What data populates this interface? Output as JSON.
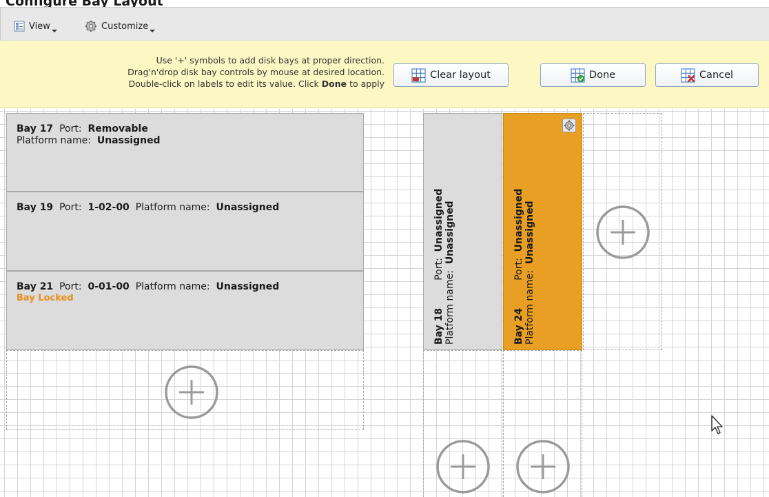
{
  "window": {
    "title": "Configure Bay Layout"
  },
  "toolbar": {
    "view_label": "View",
    "customize_label": "Customize"
  },
  "hint": {
    "line1": "Use '+' symbols to add disk bays at proper direction.",
    "line2": "Drag'n'drop disk bay controls by mouse at desired location.",
    "line3_prefix": "Double-click on labels to edit its value. Click",
    "line3_bold": "Done",
    "line3_suffix": "to apply"
  },
  "buttons": {
    "clear_layout": "Clear layout",
    "done": "Done",
    "cancel": "Cancel"
  },
  "bays": {
    "bay17": {
      "name": "Bay 17",
      "port_label": "Port:",
      "port_value": "Removable",
      "platform_label": "Platform name:",
      "platform_value": "Unassigned"
    },
    "bay19": {
      "name": "Bay 19",
      "port_label": "Port:",
      "port_value": "1-02-00",
      "platform_label": "Platform name:",
      "platform_value": "Unassigned"
    },
    "bay21": {
      "name": "Bay 21",
      "port_label": "Port:",
      "port_value": "0-01-00",
      "platform_label": "Platform name:",
      "platform_value": "Unassigned",
      "status": "Bay Locked"
    },
    "bay18": {
      "name": "Bay 18",
      "port_label": "Port:",
      "port_value": "Unassigned",
      "platform_label": "Platform name:",
      "platform_value": "Unassigned"
    },
    "bay24": {
      "name": "Bay 24",
      "port_label": "Port:",
      "port_value": "Unassigned",
      "platform_label": "Platform name:",
      "platform_value": "Unassigned",
      "selected": true
    }
  },
  "colors": {
    "bay_bg": "#dcdcdc",
    "selected_bay_bg": "#e89f24",
    "locked_text": "#e8901c",
    "hint_bg": "#fdf7c3"
  },
  "icons": {
    "view": "view-icon",
    "customize": "gear-icon",
    "clear_layout": "grid-clear-icon",
    "done": "grid-check-icon",
    "cancel": "grid-cancel-icon",
    "add_bay": "add-plus-icon",
    "bay_settings": "gear-icon",
    "cursor": "mouse-pointer-icon"
  }
}
